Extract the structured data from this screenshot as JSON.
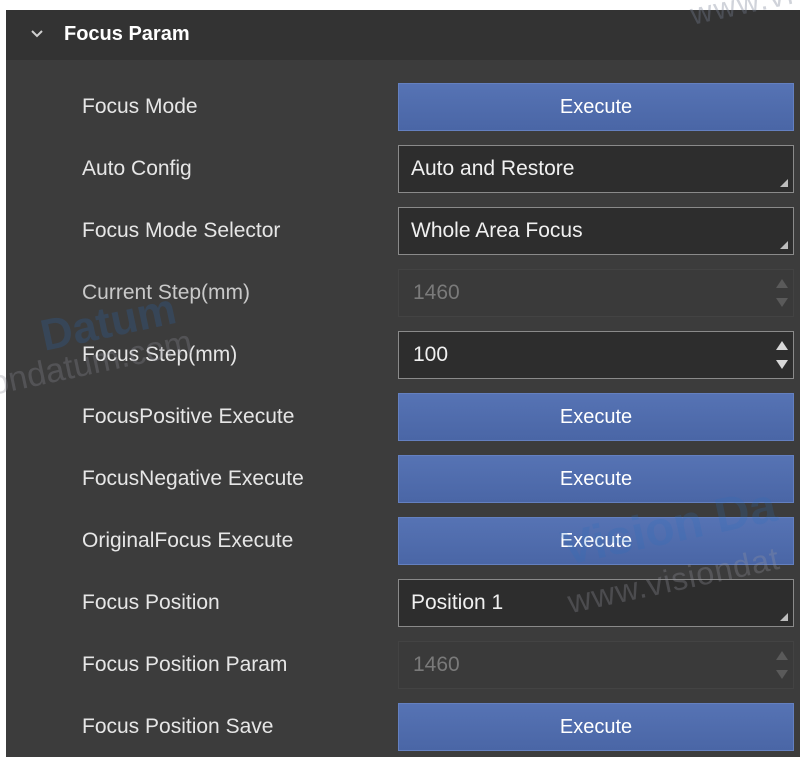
{
  "section": {
    "title": "Focus Param",
    "expanded_icon": "chevron-down-icon"
  },
  "rows": [
    {
      "label": "Focus Mode",
      "control": "button",
      "value": "Execute"
    },
    {
      "label": "Auto Config",
      "control": "combo",
      "value": "Auto and Restore"
    },
    {
      "label": "Focus Mode Selector",
      "control": "combo",
      "value": "Whole Area Focus"
    },
    {
      "label": "Current Step(mm)",
      "control": "spin",
      "value": "1460",
      "disabled": true
    },
    {
      "label": "Focus Step(mm)",
      "control": "spin",
      "value": "100",
      "disabled": false
    },
    {
      "label": "FocusPositive Execute",
      "control": "button",
      "value": "Execute"
    },
    {
      "label": "FocusNegative Execute",
      "control": "button",
      "value": "Execute"
    },
    {
      "label": "OriginalFocus Execute",
      "control": "button",
      "value": "Execute"
    },
    {
      "label": "Focus Position",
      "control": "combo",
      "value": "Position 1"
    },
    {
      "label": "Focus Position Param",
      "control": "spin",
      "value": "1460",
      "disabled": true
    },
    {
      "label": "Focus Position Save",
      "control": "button",
      "value": "Execute"
    }
  ],
  "watermarks": [
    "www.vi",
    "Datum",
    "ondatum.com",
    "Vision Da",
    "www.visiondat"
  ],
  "colors": {
    "panel": "#3c3c3c",
    "header": "#333333",
    "button": "#5170b0",
    "input": "#2d2d2d"
  }
}
